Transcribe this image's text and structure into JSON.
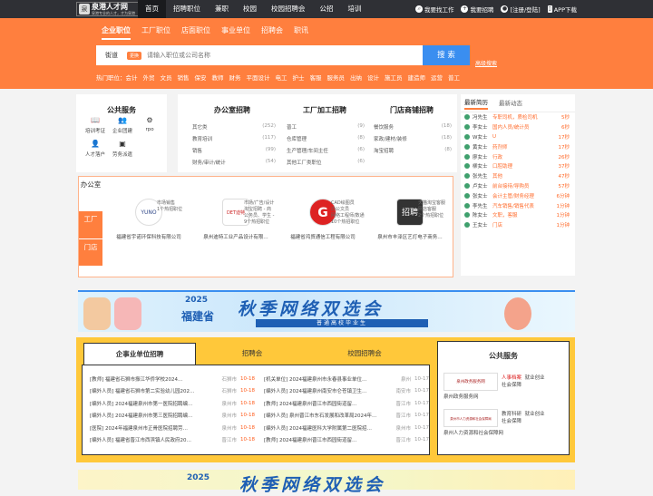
{
  "logo": {
    "line1": "泉港人才网",
    "line2": "泉港专业的人才，才为泉港",
    "mark": "泉"
  },
  "nav": [
    "首页",
    "招聘职位",
    "兼职",
    "校园",
    "校园招聘会",
    "公招",
    "培训"
  ],
  "toplinks": [
    "我要找工作",
    "我要招聘",
    "[注册/登陆]",
    "APP下载"
  ],
  "search": {
    "tabs": [
      "企业职位",
      "工厂职位",
      "店面职位",
      "事业单位",
      "招聘会",
      "职讯"
    ],
    "location": "街道",
    "change": "更换",
    "placeholder": "请输入职位或公司名称",
    "button": "搜 索",
    "advanced": "高级搜索"
  },
  "hot": {
    "label": "热门职位：",
    "items": [
      "会计",
      "外贸",
      "文员",
      "销售",
      "保安",
      "教师",
      "财务",
      "平面设计",
      "电工",
      "护士",
      "客服",
      "服务员",
      "出纳",
      "设计",
      "施工员",
      "建造师",
      "运营",
      "普工"
    ]
  },
  "public_service": {
    "title": "公共服务",
    "items": [
      {
        "label": "培训考证",
        "icon": "book-icon"
      },
      {
        "label": "企业团建",
        "icon": "group-icon"
      },
      {
        "label": "rpo",
        "icon": "briefcase-icon"
      },
      {
        "label": "人才落户",
        "icon": "person-icon"
      },
      {
        "label": "劳务派遣",
        "icon": "dispatch-icon"
      }
    ]
  },
  "office": {
    "title": "办公室招聘",
    "rows": [
      [
        "其它类",
        "(252)"
      ],
      [
        "教育培训",
        "(117)"
      ],
      [
        "销售",
        "(99)"
      ],
      [
        "财务/审计/统计",
        "(54)"
      ]
    ]
  },
  "factory": {
    "title": "工厂加工招聘",
    "rows": [
      [
        "普工",
        "(9)"
      ],
      [
        "仓库管理",
        "(8)"
      ],
      [
        "生产管理/车间主任",
        "(6)"
      ],
      [
        "其他工厂类职位",
        "(6)"
      ]
    ]
  },
  "store": {
    "title": "门店商铺招聘",
    "rows": [
      [
        "餐饮服务",
        "(18)"
      ],
      [
        "家政/建材/装修",
        "(18)"
      ],
      [
        "淘宝招聘",
        "(8)"
      ]
    ]
  },
  "news": {
    "tabs": [
      "最新简历",
      "最新动态"
    ],
    "rows": [
      [
        "冯先生",
        "专职司机，质检司机",
        "5秒"
      ],
      [
        "李女士",
        "国内人员/统计员",
        "6秒"
      ],
      [
        "W女士",
        "U",
        "17秒"
      ],
      [
        "黄女士",
        "药剂师",
        "17秒"
      ],
      [
        "廖女士",
        "行政",
        "26秒"
      ],
      [
        "柳女士",
        "口腔助理",
        "37秒"
      ],
      [
        "张先生",
        "其他",
        "47秒"
      ],
      [
        "卢女士",
        "前台接待/导购员",
        "57秒"
      ],
      [
        "张女士",
        "会计主管/财务经理",
        "6分钟"
      ],
      [
        "李先生",
        "汽车销售/销售代表",
        "1分钟"
      ],
      [
        "陈女士",
        "文职，客服",
        "1分钟"
      ],
      [
        "王女士",
        "门店",
        "1分钟"
      ]
    ]
  },
  "featured": {
    "tabs": [
      "办公室",
      "工厂",
      "门店"
    ],
    "companies": [
      {
        "name": "福建省宇诺环保科技有限公司",
        "logo": "YUNO",
        "jobs": [
          "市场销售",
          "1个热招职位"
        ]
      },
      {
        "name": "泉州迪特工业产品设计有限…",
        "logo": "DET迪特",
        "jobs": [
          "市场/广告/设计",
          "淘宝招聘 - 商",
          "公务员、学生 -",
          "9个热招职位"
        ]
      },
      {
        "name": "福建省鸿贸通信工程有限公司",
        "logo": "G",
        "jobs": [
          "CAD绘图员",
          "办公文员",
          "网络工程师/数通",
          "10个热招职位"
        ]
      },
      {
        "name": "泉州市丰泽区艺灯电子商务…",
        "logo": "招聘",
        "jobs": [
          "天猫淘宝客服",
          "网店客服",
          "2个热招职位"
        ]
      }
    ]
  },
  "banner1": {
    "year": "2025",
    "province": "福建省",
    "title": "秋季网络双选会",
    "subtitle": "普通高校毕业生"
  },
  "yellow": {
    "tabs": [
      "企事业单位招聘",
      "招聘会",
      "校园招聘会"
    ],
    "left": [
      [
        "[教师] 福建省石狮市振江华侨学校2024…",
        "石狮市",
        "10-18"
      ],
      [
        "[编外人员] 福建省石狮市第二实验幼儿园202…",
        "石狮市",
        "10-18"
      ],
      [
        "[编外人员] 2024福建泉州市第一医院招聘编…",
        "泉州市",
        "10-18"
      ],
      [
        "[编外人员] 2024福建泉州市第三医院招聘编…",
        "泉州市",
        "10-18"
      ],
      [
        "[医院] 2024年福建泉州市正骨医院招聘劳…",
        "泉州市",
        "10-18"
      ],
      [
        "[编外人员] 福建省晋江市西滨镇人民政府20…",
        "晋江市",
        "10-18"
      ]
    ],
    "right": [
      [
        "[机关单位] 2024福建泉州市永春县事业单位…",
        "泉州",
        "10-17"
      ],
      [
        "[编外人员] 2024福建泉州南安市仑苍镇卫生…",
        "南安市",
        "10-17"
      ],
      [
        "[教师] 2024福建泉州晋江市西园街道留…",
        "晋江市",
        "10-17"
      ],
      [
        "[编外人员] 泉州晋江市东石发展和改革局2024年…",
        "晋江市",
        "10-17"
      ],
      [
        "[编外人员] 2024福建医科大学附属第二医院招…",
        "泉州市",
        "10-17"
      ],
      [
        "[教师] 2024福建泉州晋江市西园街道留…",
        "晋江市",
        "10-17"
      ]
    ]
  },
  "yellow_public": {
    "title": "公共服务",
    "items": [
      {
        "logo": "泉州政务服务网",
        "label": "泉州政务服务网",
        "r1": "人事档案",
        "r2": "就业创业",
        "r3": "社会保障"
      },
      {
        "logo": "泉州市人力资源和社会保障局",
        "label": "泉州人力资源和社会保障网",
        "r1": "教育科研",
        "r2": "就业创业",
        "r3": "社会保障"
      }
    ]
  },
  "banner2": {
    "year": "2025",
    "title": "秋季网络双选会"
  }
}
